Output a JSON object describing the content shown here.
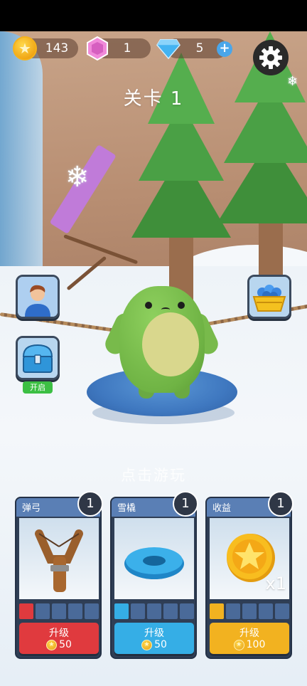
{
  "hud": {
    "coins": "143",
    "gems": "1",
    "diamonds": "5",
    "add_symbol": "+"
  },
  "level": {
    "title": "关卡 1"
  },
  "side": {
    "open_label": "开启"
  },
  "hint": {
    "tap_to_play": "点击游玩"
  },
  "cards": [
    {
      "title": "弹弓",
      "level": "1",
      "upgrade_label": "升级",
      "cost": "50",
      "filled_segments": 1,
      "total_segments": 5,
      "accent": "#e03a3e"
    },
    {
      "title": "雪橇",
      "level": "1",
      "upgrade_label": "升级",
      "cost": "50",
      "filled_segments": 1,
      "total_segments": 5,
      "accent": "#35aee6"
    },
    {
      "title": "收益",
      "level": "1",
      "upgrade_label": "升级",
      "cost": "100",
      "filled_segments": 1,
      "total_segments": 5,
      "accent": "#f2b220",
      "multiplier": "x1"
    }
  ],
  "colors": {
    "coin": "#f5b21b",
    "gem": "#e58ad6",
    "diamond": "#3ea8ec",
    "card_bg": "#2f3e55",
    "card_head": "#5a7fb5"
  },
  "icons": [
    "star-coin-icon",
    "pink-gem-icon",
    "blue-diamond-icon",
    "plus-icon",
    "gear-icon",
    "avatar-icon",
    "chest-icon",
    "gem-basket-icon",
    "slingshot-icon",
    "snow-tube-icon",
    "gold-coin-icon"
  ]
}
